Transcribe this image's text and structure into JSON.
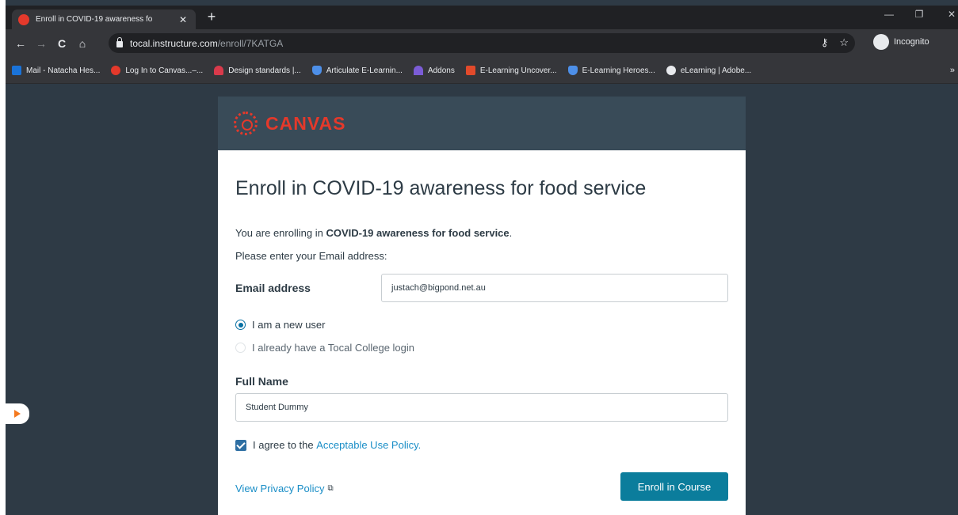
{
  "browser": {
    "tab_title": "Enroll in COVID-19 awareness fo",
    "tab_close": "✕",
    "new_tab": "+",
    "window_minimize": "—",
    "window_restore": "❐",
    "window_close": "✕",
    "url_host": "tocal.instructure.com",
    "url_path": "/enroll/7KATGA",
    "incognito_label": "Incognito",
    "key_glyph": "⚷",
    "star_glyph": "☆",
    "menu_glyph": "⋮",
    "nav_back": "←",
    "nav_forward": "→",
    "nav_reload": "C",
    "nav_home": "⌂"
  },
  "bookmarks": [
    {
      "label": "Mail - Natacha Hes...",
      "icon": "outlook-icon",
      "color": "#1a73d9"
    },
    {
      "label": "Log In to Canvas...–...",
      "icon": "canvas-icon",
      "color": "#e4392b"
    },
    {
      "label": "Design standards |...",
      "icon": "design-icon",
      "color": "#d93a4b"
    },
    {
      "label": "Articulate E-Learnin...",
      "icon": "shield-icon",
      "color": "#4d8fe8"
    },
    {
      "label": "Addons",
      "icon": "addons-icon",
      "color": "#7b5cd6"
    },
    {
      "label": "E-Learning Uncover...",
      "icon": "bookmark-icon",
      "color": "#e24a2b"
    },
    {
      "label": "E-Learning Heroes...",
      "icon": "shield-icon",
      "color": "#4d8fe8"
    },
    {
      "label": "eLearning | Adobe...",
      "icon": "globe-icon",
      "color": "#e8eaed"
    }
  ],
  "bookmarks_more": "»",
  "header": {
    "brand": "CANVAS"
  },
  "form": {
    "title": "Enroll in COVID-19 awareness for food service",
    "intro_prefix": "You are enrolling in ",
    "intro_course": "COVID-19 awareness for food service",
    "intro_suffix": ".",
    "prompt": "Please enter your Email address:",
    "email_label": "Email address",
    "email_value": "justach@bigpond.net.au",
    "radio_new": "I am a new user",
    "radio_existing": "I already have a Tocal College login",
    "fullname_label": "Full Name",
    "fullname_value": "Student Dummy",
    "agree_prefix": "I agree to the ",
    "agree_link": "Acceptable Use Policy.",
    "privacy_link": "View Privacy Policy",
    "privacy_icon": "⧉",
    "submit": "Enroll in Course"
  }
}
